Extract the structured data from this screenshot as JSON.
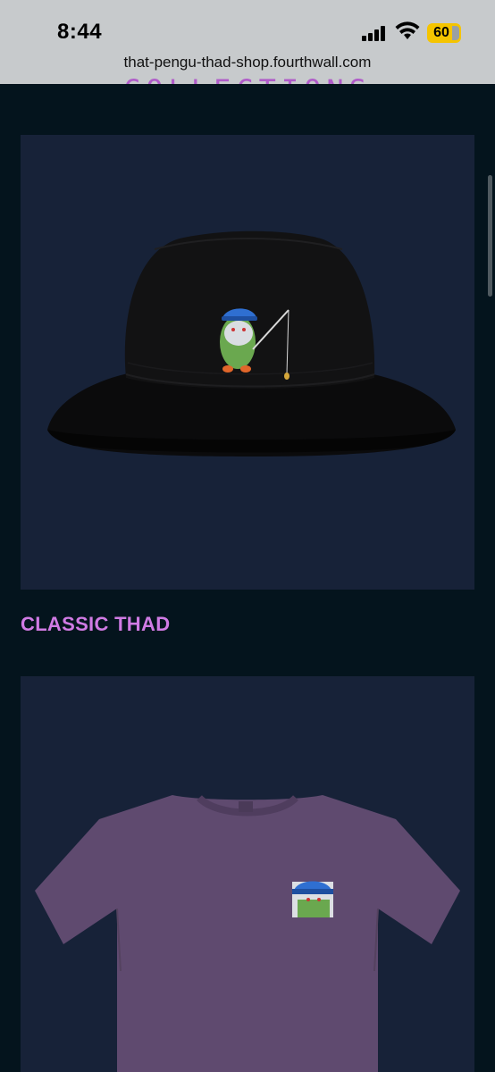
{
  "status_bar": {
    "time": "8:44",
    "battery": "60"
  },
  "browser": {
    "url": "that-pengu-thad-shop.fourthwall.com"
  },
  "page": {
    "section_heading": "COLLECTIONS",
    "collections": [
      {
        "title": "",
        "product": "bucket hat",
        "image_icon": "bucket-hat-fishing-penguin"
      },
      {
        "title": "CLASSIC THAD",
        "product": "t-shirt",
        "image_icon": "purple-tshirt-penguin"
      }
    ]
  },
  "colors": {
    "background": "#04141d",
    "card": "#172238",
    "accent": "#d07be4",
    "battery": "#f5c400"
  }
}
